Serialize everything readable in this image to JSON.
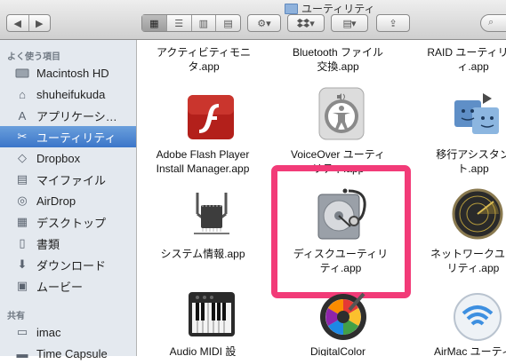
{
  "window": {
    "title": "ユーティリティ"
  },
  "toolbar": {
    "back": "◀",
    "forward": "▶",
    "views": [
      "▦",
      "☰",
      "▥",
      "▤"
    ],
    "gear": "⚙▾",
    "dropbox": "▾",
    "arrange": "▾",
    "share": "⇪"
  },
  "sidebar": {
    "favorites_label": "よく使う項目",
    "favorites": [
      {
        "label": "Macintosh HD",
        "icon": "hard-drive-icon"
      },
      {
        "label": "shuheifukuda",
        "icon": "home-icon"
      },
      {
        "label": "アプリケーシ…",
        "icon": "applications-icon"
      },
      {
        "label": "ユーティリティ",
        "icon": "utilities-icon",
        "selected": true
      },
      {
        "label": "Dropbox",
        "icon": "dropbox-icon"
      },
      {
        "label": "マイファイル",
        "icon": "all-my-files-icon"
      },
      {
        "label": "AirDrop",
        "icon": "airdrop-icon"
      },
      {
        "label": "デスクトップ",
        "icon": "desktop-icon"
      },
      {
        "label": "書類",
        "icon": "documents-icon"
      },
      {
        "label": "ダウンロード",
        "icon": "downloads-icon"
      },
      {
        "label": "ムービー",
        "icon": "movies-icon"
      }
    ],
    "shared_label": "共有",
    "shared": [
      {
        "label": "imac",
        "icon": "computer-icon"
      },
      {
        "label": "Time Capsule",
        "icon": "time-capsule-icon"
      }
    ]
  },
  "files": [
    {
      "label": "アクティビティモニ\nタ.app"
    },
    {
      "label": "Bluetooth ファイル\n交換.app"
    },
    {
      "label": "RAID ユーティリテ\nィ.app"
    },
    {
      "label": "Adobe Flash Player\nInstall Manager.app"
    },
    {
      "label": "VoiceOver ユーティ\nリティ.app"
    },
    {
      "label": "移行アシスタン\nト.app"
    },
    {
      "label": "システム情報.app"
    },
    {
      "label": "ディスクユーティリ\nティ.app"
    },
    {
      "label": "ネットワークユー\nリティ.app"
    },
    {
      "label": "Audio MIDI 設"
    },
    {
      "label": "DigitalColor"
    },
    {
      "label": "AirMac ユーティ"
    }
  ],
  "colors": {
    "selection": "#3b76c9",
    "highlight": "#f23b78",
    "flash": "#c92a22"
  }
}
